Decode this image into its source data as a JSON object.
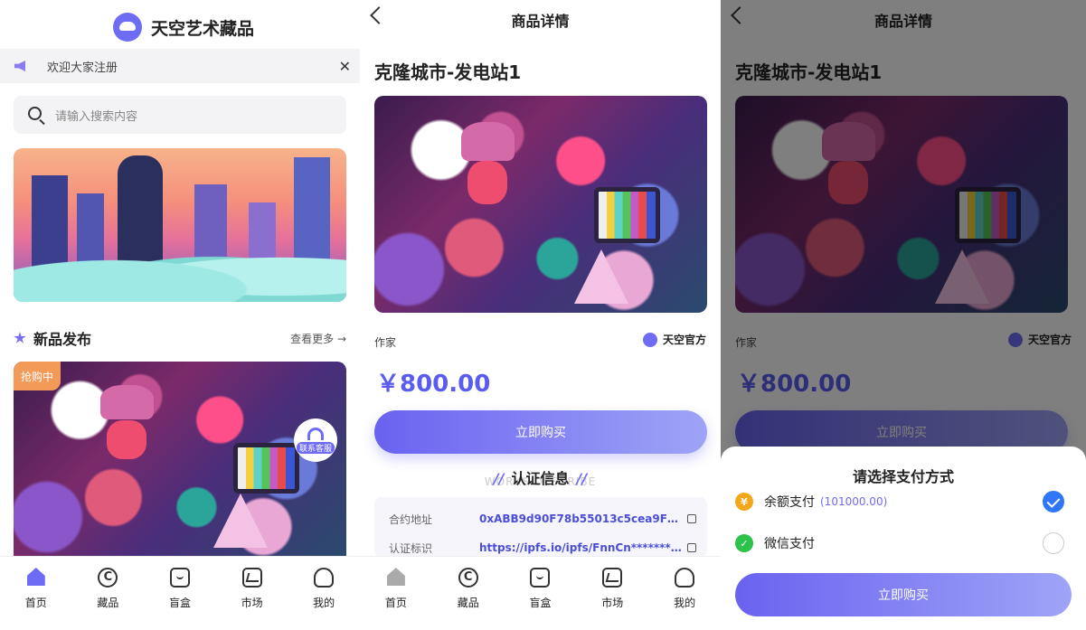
{
  "home": {
    "brand_name": "天空艺术藏品",
    "notice": "欢迎大家注册",
    "search_placeholder": "请输入搜索内容",
    "section_title": "新品发布",
    "section_more": "查看更多 →",
    "badge": "抢购中",
    "customer_service": "联系客服",
    "tabs": [
      {
        "label": "首页",
        "icon": "home-icon",
        "active": true
      },
      {
        "label": "藏品",
        "icon": "copyright-icon"
      },
      {
        "label": "盲盒",
        "icon": "box-icon"
      },
      {
        "label": "市场",
        "icon": "market-icon"
      },
      {
        "label": "我的",
        "icon": "user-icon"
      }
    ]
  },
  "detail": {
    "nav_title": "商品详情",
    "title": "克隆城市-发电站1",
    "author_label": "作家",
    "author_name": "天空官方",
    "price": "￥800.00",
    "buy_label": "立即购买",
    "cert_title": "认证信息",
    "cert_subtitle": "WORKS DESCRIBE",
    "cert_rows": [
      {
        "key": "合约地址",
        "value": "0xABB9d90F78b55013c5cea9F91…"
      },
      {
        "key": "认证标识",
        "value": "https://ipfs.io/ipfs/FnnCn*******…"
      }
    ],
    "tabs": [
      {
        "label": "首页",
        "icon": "home-icon"
      },
      {
        "label": "藏品",
        "icon": "copyright-icon"
      },
      {
        "label": "盲盒",
        "icon": "box-icon"
      },
      {
        "label": "市场",
        "icon": "market-icon"
      },
      {
        "label": "我的",
        "icon": "user-icon"
      }
    ]
  },
  "payment": {
    "nav_title": "商品详情",
    "title": "克隆城市-发电站1",
    "author_label": "作家",
    "author_name": "天空官方",
    "price": "￥800.00",
    "buy_label": "立即购买",
    "sheet_title": "请选择支付方式",
    "methods": [
      {
        "label": "余额支付",
        "balance": "(101000.00)",
        "selected": true,
        "icon": "wallet-icon"
      },
      {
        "label": "微信支付",
        "selected": false,
        "icon": "wechat-icon"
      }
    ],
    "confirm_label": "立即购买"
  },
  "colors": {
    "accent": "#6e6cf5",
    "price": "#5a5cf0",
    "badge": "#f39a58",
    "check": "#2f77f6"
  }
}
